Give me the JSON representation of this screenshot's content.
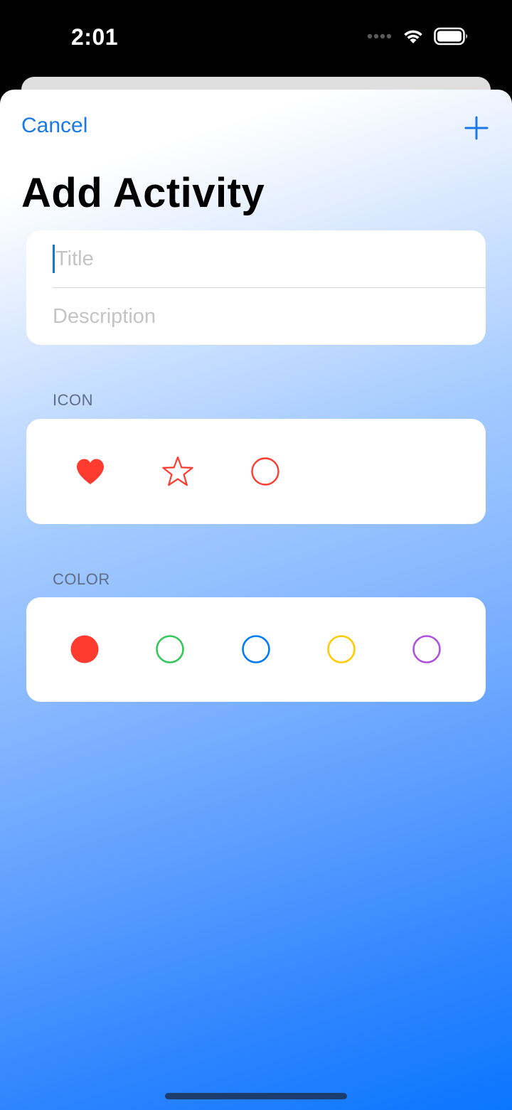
{
  "status": {
    "time": "2:01",
    "icons": [
      "signal-icon",
      "wifi-icon",
      "battery-icon"
    ]
  },
  "nav": {
    "cancel_label": "Cancel",
    "add_icon": "plus-icon"
  },
  "page": {
    "title": "Add Activity"
  },
  "form": {
    "title_placeholder": "Title",
    "title_value": "",
    "description_placeholder": "Description",
    "description_value": ""
  },
  "icon_section": {
    "header": "ICON",
    "options": [
      {
        "name": "heart-icon",
        "style": "filled",
        "selected": true
      },
      {
        "name": "star-icon",
        "style": "outline",
        "selected": false
      },
      {
        "name": "circle-icon",
        "style": "outline",
        "selected": false
      }
    ],
    "tint": "#ff3b30"
  },
  "color_section": {
    "header": "COLOR",
    "options": [
      {
        "name": "red",
        "hex": "#ff3b30",
        "selected": true
      },
      {
        "name": "green",
        "hex": "#34c759",
        "selected": false
      },
      {
        "name": "blue",
        "hex": "#007aff",
        "selected": false
      },
      {
        "name": "yellow",
        "hex": "#ffcc00",
        "selected": false
      },
      {
        "name": "purple",
        "hex": "#af52de",
        "selected": false
      }
    ]
  },
  "theme": {
    "accent": "#1a79e6",
    "gradient_start": "#ffffff",
    "gradient_end": "#0a76ff"
  }
}
